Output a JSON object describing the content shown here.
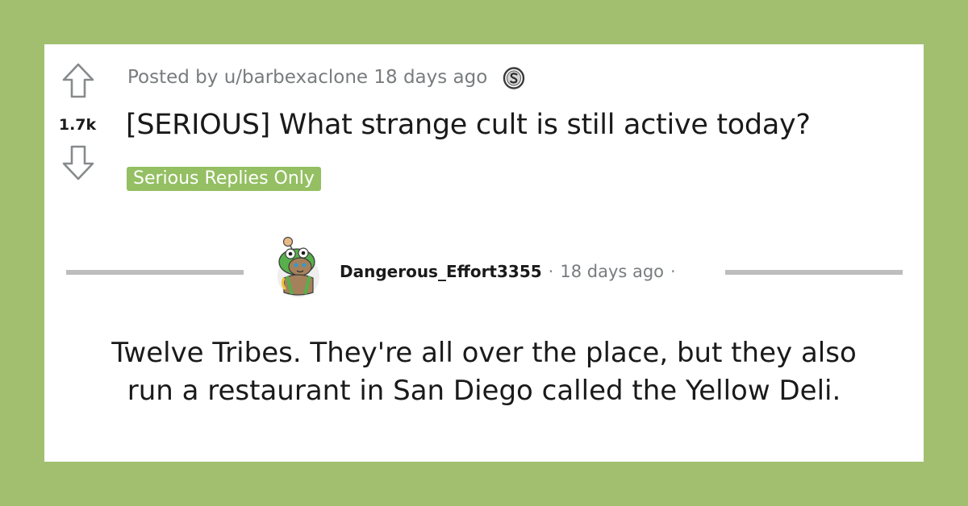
{
  "post": {
    "score": "1.7k",
    "posted_by": "Posted by u/barbexaclone 18 days ago",
    "title": "[SERIOUS] What strange cult is still active today?",
    "flair": "Serious Replies Only"
  },
  "comment": {
    "author": "Dangerous_Effort3355",
    "time": "18 days ago",
    "separator": "·",
    "body_line1": "Twelve Tribes. They're all over the place, but they also",
    "body_line2": "run a restaurant in San Diego called the Yellow Deli."
  },
  "icons": {
    "upvote": "upvote-arrow-icon",
    "downvote": "downvote-arrow-icon",
    "award": "silver-award-icon",
    "avatar": "snoo-frog-hood-avatar"
  },
  "colors": {
    "background": "#a2bf6f",
    "card": "#ffffff",
    "flair": "#94bf62",
    "meta_text": "#787c7e",
    "rule": "#bdbdbd"
  }
}
